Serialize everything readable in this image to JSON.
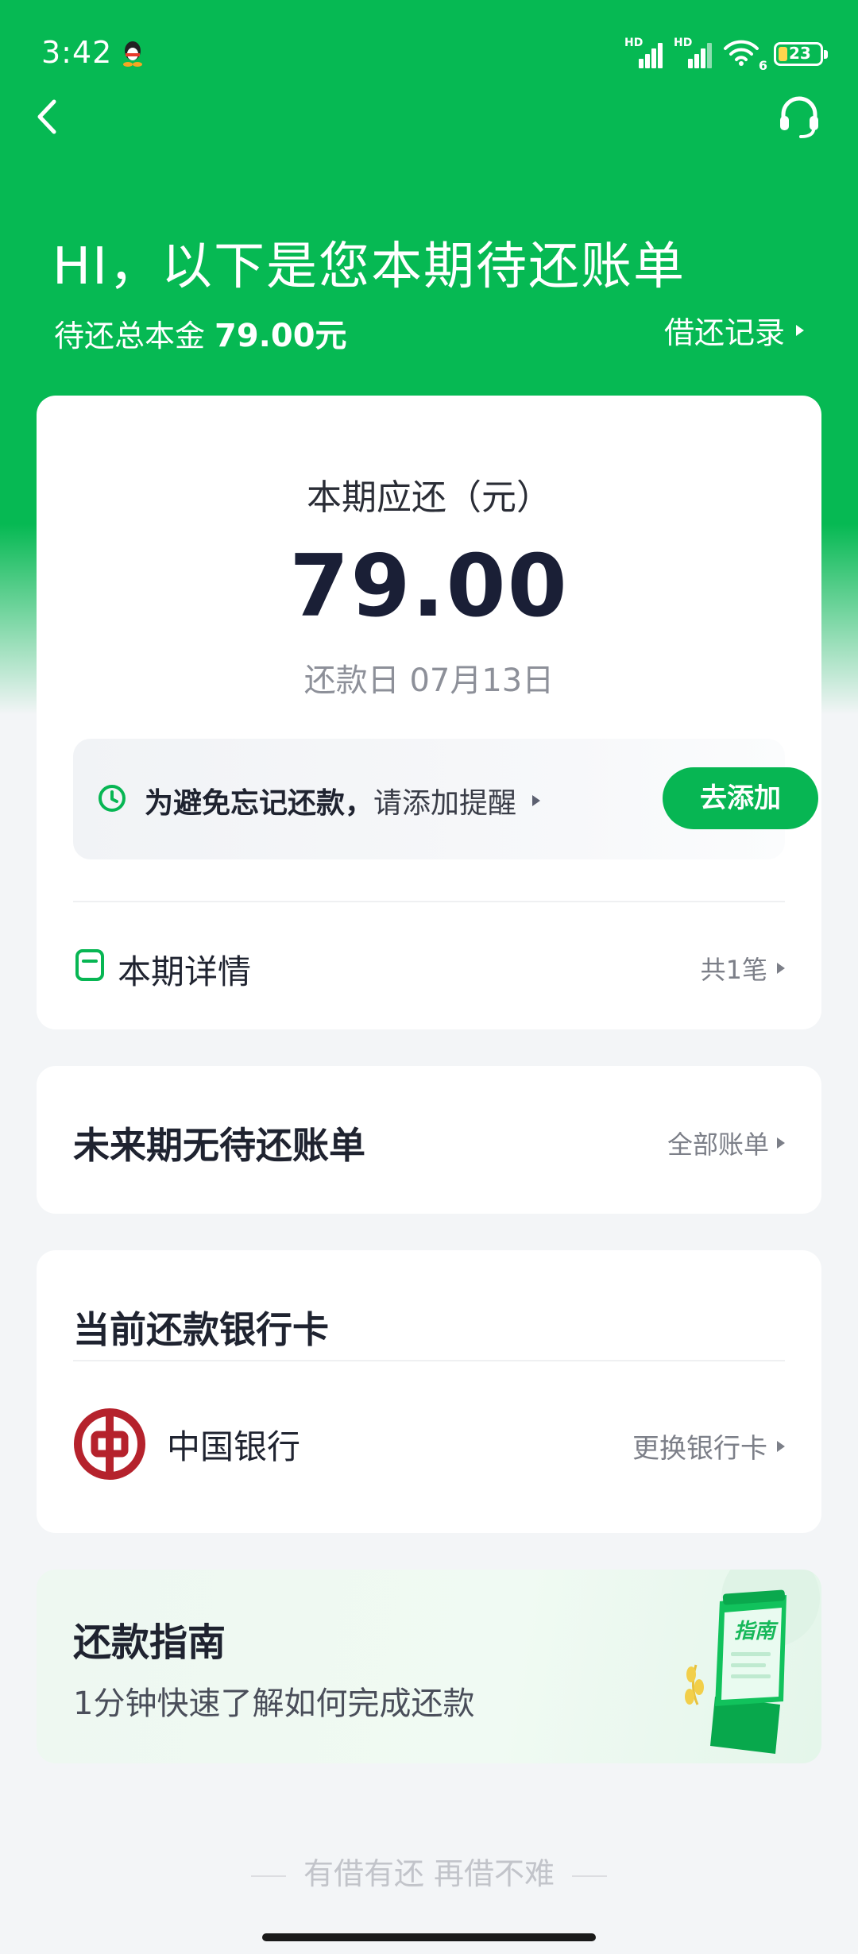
{
  "status_bar": {
    "time": "3:42",
    "hd1": "HD",
    "hd2": "HD",
    "wifi_badge": "6",
    "battery": "23"
  },
  "header": {
    "title": "HI，以下是您本期待还账单",
    "principal_label": "待还总本金",
    "principal_amount": "79.00元",
    "record_link": "借还记录"
  },
  "current_bill": {
    "due_label": "本期应还（元）",
    "amount": "79.00",
    "due_date": "还款日 07月13日",
    "reminder_bold": "为避免忘记还款，",
    "reminder_text": "请添加提醒",
    "add_button": "去添加",
    "detail_label": "本期详情",
    "detail_count": "共1笔"
  },
  "future": {
    "title": "未来期无待还账单",
    "all_bills": "全部账单"
  },
  "bank": {
    "title": "当前还款银行卡",
    "bank_name": "中国银行",
    "change_card": "更换银行卡"
  },
  "guide": {
    "title": "还款指南",
    "subtitle": "1分钟快速了解如何完成还款",
    "badge": "指南"
  },
  "footer": {
    "slogan": "有借有还 再借不难"
  },
  "colors": {
    "brand_green": "#06b953",
    "boc_red": "#b5222c"
  }
}
